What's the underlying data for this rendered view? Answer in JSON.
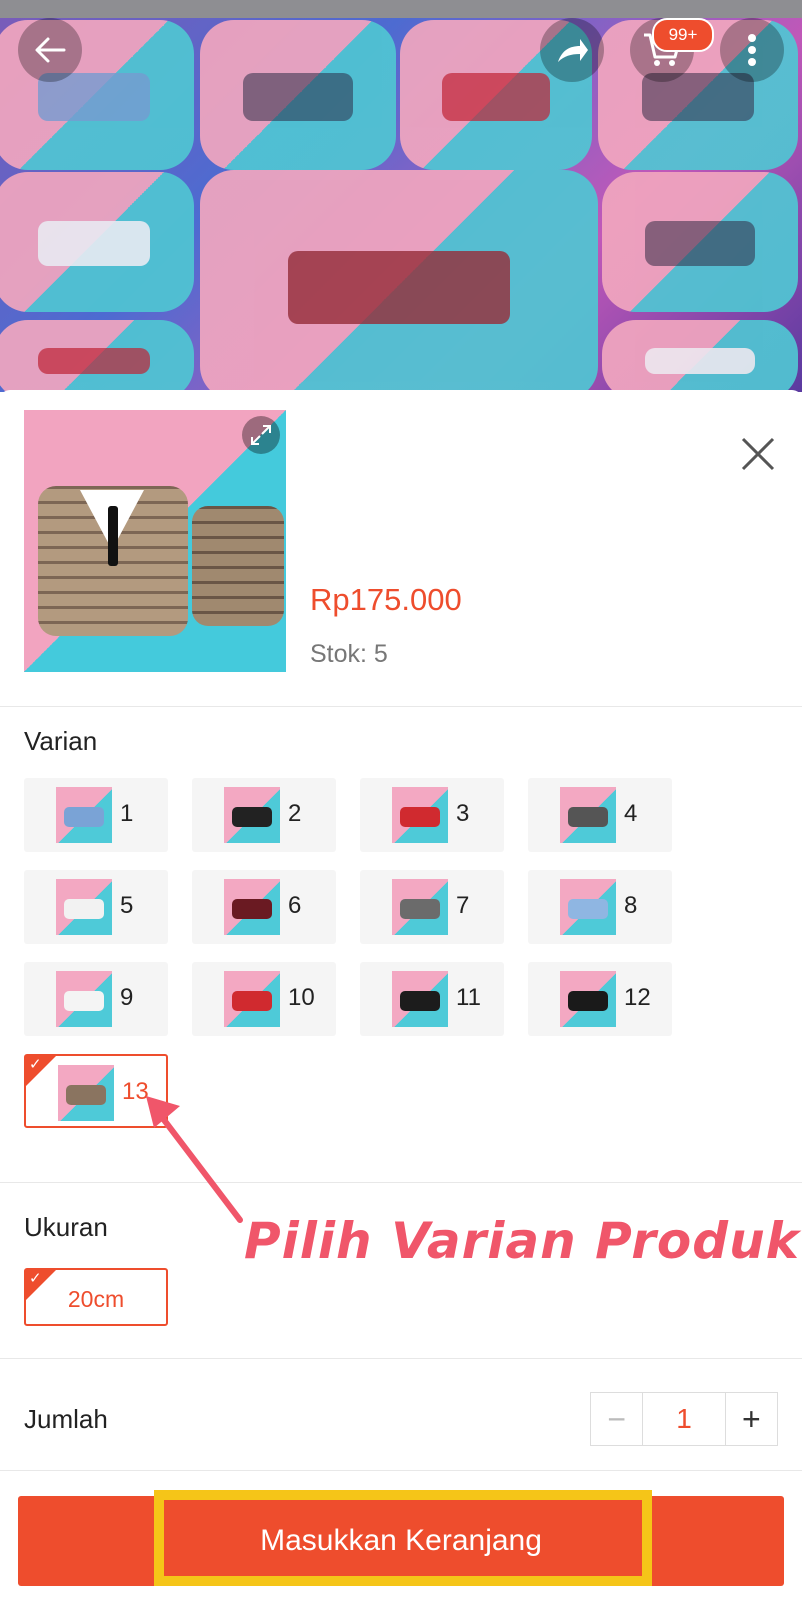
{
  "header": {
    "cart_badge": "99+",
    "icons": [
      "back-arrow-icon",
      "share-icon",
      "cart-icon",
      "more-vertical-icon"
    ]
  },
  "product": {
    "price": "Rp175.000",
    "stock": "Stok: 5"
  },
  "variants": {
    "label": "Varian",
    "items": [
      {
        "label": "1",
        "color": "#7aa3d6"
      },
      {
        "label": "2",
        "color": "#222222"
      },
      {
        "label": "3",
        "color": "#d02a2f"
      },
      {
        "label": "4",
        "color": "#555555"
      },
      {
        "label": "5",
        "color": "#f2f2f2"
      },
      {
        "label": "6",
        "color": "#6a1a22"
      },
      {
        "label": "7",
        "color": "#6b6b6b"
      },
      {
        "label": "8",
        "color": "#8fb6e2"
      },
      {
        "label": "9",
        "color": "#f4f4f4"
      },
      {
        "label": "10",
        "color": "#d02a2f"
      },
      {
        "label": "11",
        "color": "#1c1c1c"
      },
      {
        "label": "12",
        "color": "#1a1a1a"
      },
      {
        "label": "13",
        "color": "#8a7460"
      }
    ],
    "selected": "13"
  },
  "size": {
    "label": "Ukuran",
    "selected": "20cm"
  },
  "annotation": {
    "text": "Pilih Varian Produk",
    "color": "#f0566a"
  },
  "quantity": {
    "label": "Jumlah",
    "value": "1",
    "minus": "−",
    "plus": "+"
  },
  "cta": {
    "label": "Masukkan Keranjang"
  },
  "colors": {
    "accent": "#ee4d2d",
    "highlight_frame": "#f5c518"
  }
}
